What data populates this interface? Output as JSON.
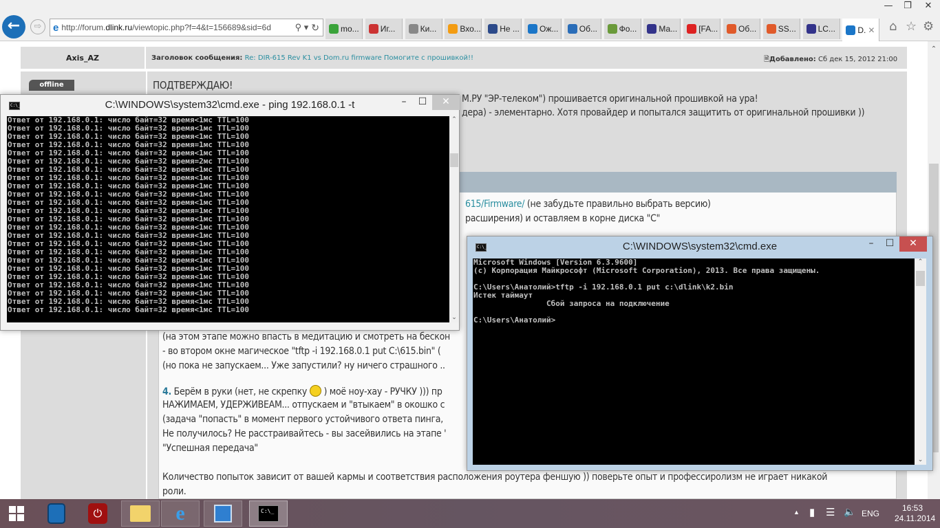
{
  "browser": {
    "url_prefix": "http://forum.",
    "url_domain": "dlink.ru",
    "url_rest": "/viewtopic.php?f=4&t=156689&sid=6d",
    "tabs": [
      {
        "label": "mo...",
        "color": "#3aa33a"
      },
      {
        "label": "Иг...",
        "color": "#c33"
      },
      {
        "label": "Ки...",
        "color": "#888"
      },
      {
        "label": "Вхо...",
        "color": "#f39c12"
      },
      {
        "label": "Не ...",
        "color": "#2c4a8a"
      },
      {
        "label": "Ож...",
        "color": "#1b76c8"
      },
      {
        "label": "Об...",
        "color": "#2a6db8"
      },
      {
        "label": "Фо...",
        "color": "#6a9a3a"
      },
      {
        "label": "Ма...",
        "color": "#33338a"
      },
      {
        "label": "[FA...",
        "color": "#d22"
      },
      {
        "label": "Об...",
        "color": "#e05a2a"
      },
      {
        "label": "SS...",
        "color": "#e05a2a"
      },
      {
        "label": "LC...",
        "color": "#33338a"
      },
      {
        "label": "D.",
        "color": "#1b76c8"
      }
    ]
  },
  "post": {
    "author": "Axis_AZ",
    "status": "offline",
    "subject_label": "Заголовок сообщения:",
    "subject": "Re: DIR-615 Rev K1 vs Dom.ru firmware Помогите с прошивкой!!",
    "added_label": "Добавлено:",
    "added_date": "Сб дек 15, 2012 21:00",
    "line1": "ПОДТВЕРЖДАЮ!",
    "line2": "М.РУ \"ЭР-телеком\") прошивается оригинальной прошивкой на ура!",
    "line3": "дера) - элементарно. Хотя провайдер и попытался защитить от оригинальной прошивки ))",
    "quote_link": "615/Firmware/",
    "quote_line1": " (не забудьте правильно выбрать версию)",
    "quote_line2": "расширения) и оставляем в корне диска \"С\"",
    "q3": "(на этом этапе можно впасть в медитацию и смотреть на бескон",
    "q4": "- во втором окне магическое \"tftp -i 192.168.0.1 put C:\\615.bin\" (",
    "q5": "(но пока не запускаем... Уже запустили? ну ничего страшного ..",
    "q6_num": "4.",
    "q6a": " Берём в руки (нет, не скрепку ",
    "q6b": " ) моё ноу-хау - РУЧКУ ))) пр",
    "q7": "НАЖИМАЕМ, УДЕРЖИВЕАМ... отпускаем и \"втыкаем\" в окошко с",
    "q8": "(задача \"попасть\" в момент первого устойчивого ответа пинга, ",
    "q9": "Не получилось? Не расстраивайтесь - вы засейвились на этапе '",
    "q10": "\"Успешная передача\"",
    "q11": "Количество попыток зависит от вашей кармы и соответствия расположения роутера феншую )) поверьте опыт и профессиролизм не играет никакой",
    "q12": "роли."
  },
  "ping_window": {
    "title": "C:\\WINDOWS\\system32\\cmd.exe - ping  192.168.0.1 -t",
    "lines": [
      "Ответ от 192.168.0.1: число байт=32 время<1мс TTL=100",
      "Ответ от 192.168.0.1: число байт=32 время<1мс TTL=100",
      "Ответ от 192.168.0.1: число байт=32 время<1мс TTL=100",
      "Ответ от 192.168.0.1: число байт=32 время=1мс TTL=100",
      "Ответ от 192.168.0.1: число байт=32 время<1мс TTL=100",
      "Ответ от 192.168.0.1: число байт=32 время=2мс TTL=100",
      "Ответ от 192.168.0.1: число байт=32 время<1мс TTL=100",
      "Ответ от 192.168.0.1: число байт=32 время<1мс TTL=100",
      "Ответ от 192.168.0.1: число байт=32 время<1мс TTL=100",
      "Ответ от 192.168.0.1: число байт=32 время<1мс TTL=100",
      "Ответ от 192.168.0.1: число байт=32 время<1мс TTL=100",
      "Ответ от 192.168.0.1: число байт=32 время=1мс TTL=100",
      "Ответ от 192.168.0.1: число байт=32 время<1мс TTL=100",
      "Ответ от 192.168.0.1: число байт=32 время<1мс TTL=100",
      "Ответ от 192.168.0.1: число байт=32 время<1мс TTL=100",
      "Ответ от 192.168.0.1: число байт=32 время<1мс TTL=100",
      "Ответ от 192.168.0.1: число байт=32 время=1мс TTL=100",
      "Ответ от 192.168.0.1: число байт=32 время<1мс TTL=100",
      "Ответ от 192.168.0.1: число байт=32 время<1мс TTL=100",
      "Ответ от 192.168.0.1: число байт=32 время<1мс TTL=100",
      "Ответ от 192.168.0.1: число байт=32 время<1мс TTL=100",
      "Ответ от 192.168.0.1: число байт=32 время<1мс TTL=100",
      "Ответ от 192.168.0.1: число байт=32 время<1мс TTL=100",
      "Ответ от 192.168.0.1: число байт=32 время<1мс TTL=100"
    ]
  },
  "tftp_window": {
    "title": "C:\\WINDOWS\\system32\\cmd.exe",
    "lines": [
      "Microsoft Windows [Version 6.3.9600]",
      "(c) Корпорация Майкрософт (Microsoft Corporation), 2013. Все права защищены.",
      "",
      "C:\\Users\\Анатолий>tftp -i 192.168.0.1 put c:\\dlink\\k2.bin",
      "Истек таймаут",
      "                Сбой запроса на подключение",
      "",
      "C:\\Users\\Анатолий>"
    ]
  },
  "taskbar": {
    "language": "ENG",
    "time": "16:53",
    "date": "24.11.2014"
  }
}
